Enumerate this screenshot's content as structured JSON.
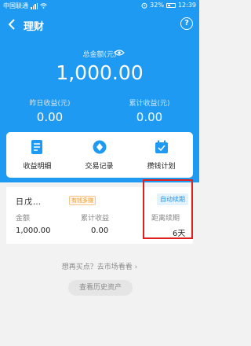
{
  "status_bar": {
    "carrier": "中国联通",
    "battery": "32%",
    "time": "12:39"
  },
  "nav": {
    "title": "理财",
    "help": "?"
  },
  "summary": {
    "total_label": "总金额(元)",
    "total_value": "1,000.00",
    "yesterday_label": "昨日收益(元)",
    "yesterday_value": "0.00",
    "cumulative_label": "累计收益(元)",
    "cumulative_value": "0.00"
  },
  "actions": [
    {
      "label": "收益明细",
      "icon": "document-icon"
    },
    {
      "label": "交易记录",
      "icon": "coin-icon"
    },
    {
      "label": "攒钱计划",
      "icon": "calendar-icon"
    }
  ],
  "product": {
    "name": "日戊…",
    "tag": "有钱多赚",
    "badge": "自动续期",
    "amount_label": "金额",
    "amount_value": "1,000.00",
    "income_label": "累计收益",
    "income_value": "0.00",
    "renew_label": "距离续期",
    "renew_value": "6天"
  },
  "footer": {
    "prompt": "想再买点？去市场看看 ›",
    "history_button": "查看历史资产"
  },
  "colors": {
    "primary_blue": "#1e9af2",
    "highlight_red": "#e01e1e",
    "tag_orange": "#f39a2a"
  }
}
